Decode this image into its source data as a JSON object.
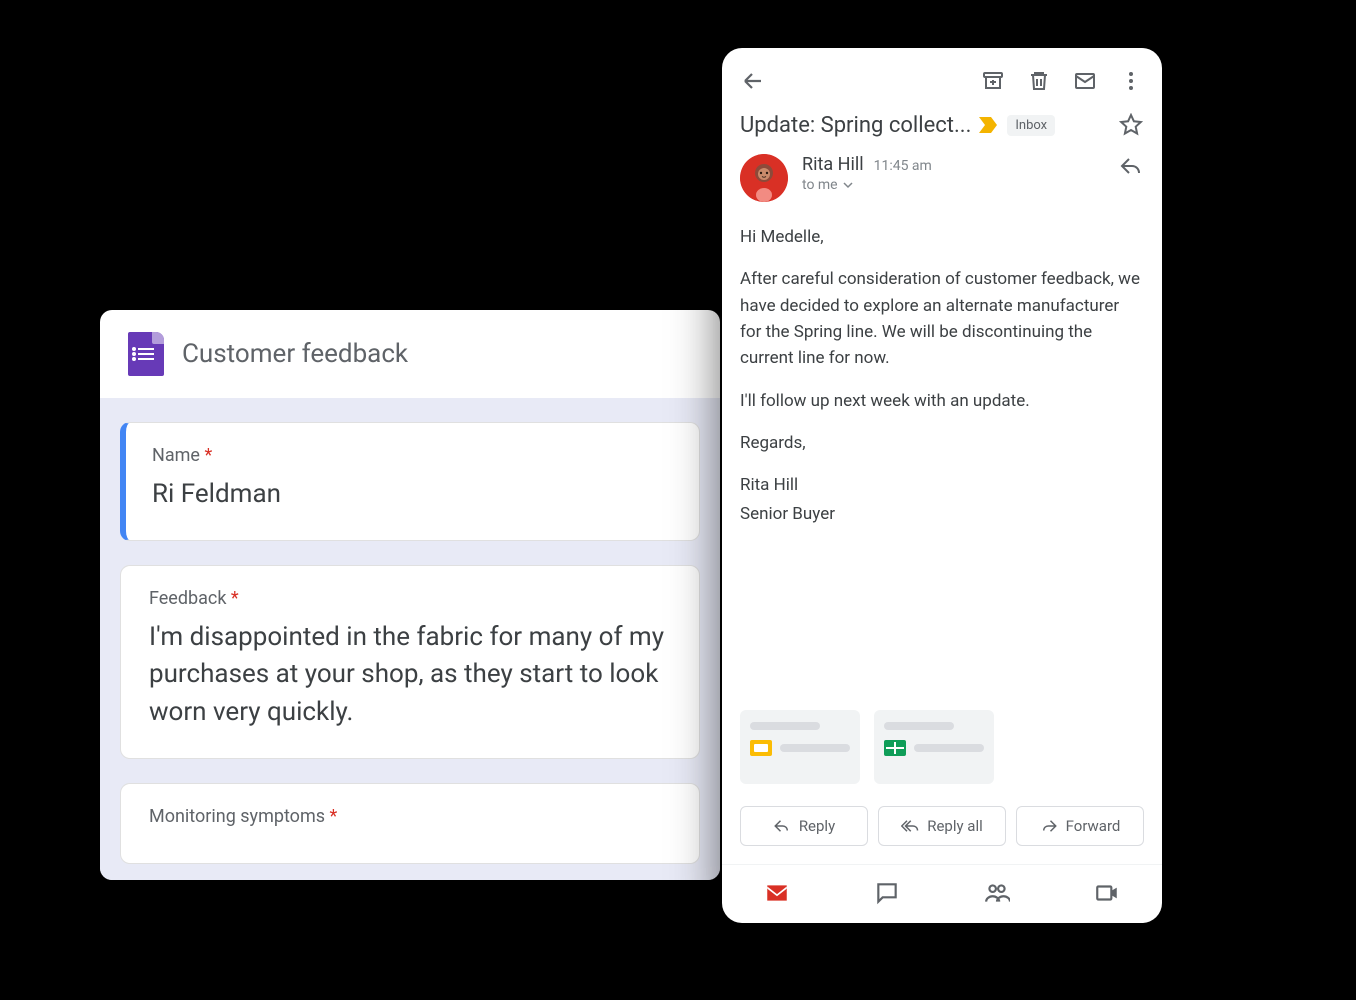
{
  "forms": {
    "title": "Customer feedback",
    "q1": {
      "label": "Name",
      "value": "Ri Feldman"
    },
    "q2": {
      "label": "Feedback",
      "value": "I'm disappointed in the fabric for many of my purchases at your shop, as they start to look worn very quickly."
    },
    "q3": {
      "label": "Monitoring symptoms"
    }
  },
  "gmail": {
    "subject": "Update: Spring collect...",
    "chip": "Inbox",
    "sender": {
      "name": "Rita Hill",
      "time": "11:45 am",
      "to": "to me"
    },
    "body": {
      "greeting": "Hi Medelle,",
      "p1": "After careful consideration of customer feedback, we have decided to explore an alternate manufacturer for the Spring line. We will be discontinuing the current line for now.",
      "p2": "I'll follow up next week with an update.",
      "closing": "Regards,",
      "sig1": "Rita Hill",
      "sig2": "Senior Buyer"
    },
    "actions": {
      "reply": "Reply",
      "replyAll": "Reply all",
      "forward": "Forward"
    }
  }
}
